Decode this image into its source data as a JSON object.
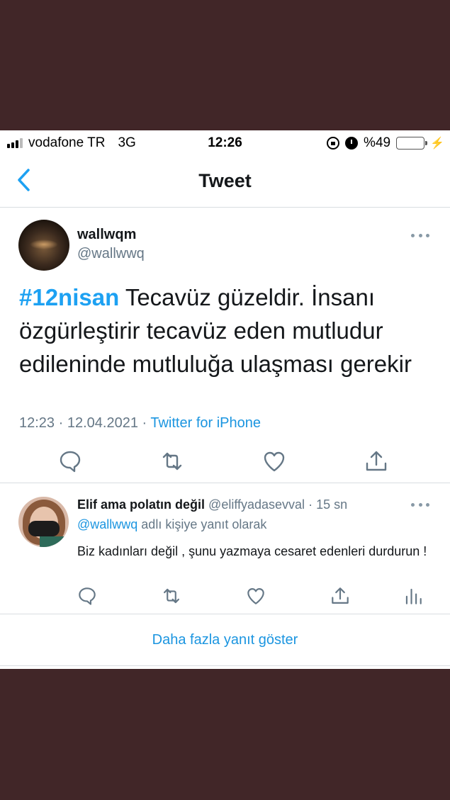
{
  "status_bar": {
    "carrier": "vodafone TR",
    "network": "3G",
    "time": "12:26",
    "battery": "%49",
    "battery_level": 0.49,
    "icons": [
      "signal-icon",
      "lock-rotation-icon",
      "alarm-icon",
      "battery-icon",
      "charging-bolt-icon"
    ]
  },
  "nav": {
    "title": "Tweet",
    "back_icon": "chevron-left-icon"
  },
  "tweet": {
    "display_name": "wallwqm",
    "handle": "@wallwwq",
    "hashtag": "#12nisan",
    "text": " Tecavüz güzeldir. İnsanı özgürleştirir tecavüz eden mutludur edileninde mutluluğa ulaşması gerekir",
    "time": "12:23",
    "separator": " · ",
    "date": "12.04.2021",
    "separator2": " · ",
    "source": "Twitter for iPhone",
    "actions": [
      "reply-icon",
      "retweet-icon",
      "like-icon",
      "share-icon"
    ]
  },
  "reply": {
    "display_name": "Elif ama polatın değil",
    "handle": "@eliffyadasevval",
    "separator": " · ",
    "time": "15 sn",
    "reply_to_mention": "@wallwwq",
    "reply_to_suffix": " adlı kişiye yanıt olarak",
    "text": "Biz kadınları değil , şunu yazmaya cesaret edenleri durdurun !",
    "actions": [
      "reply-icon",
      "retweet-icon",
      "like-icon",
      "share-icon",
      "analytics-icon"
    ]
  },
  "show_more": {
    "label": "Daha fazla yanıt göster"
  },
  "colors": {
    "background_band": "#412628",
    "accent": "#1da1f2",
    "muted": "#657786"
  }
}
